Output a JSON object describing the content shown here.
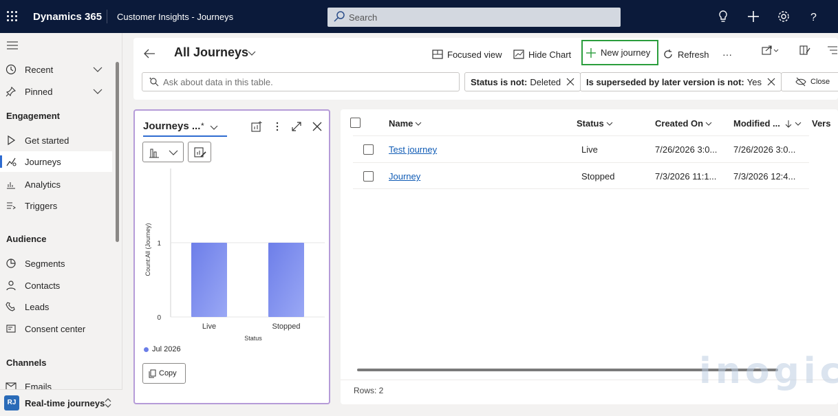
{
  "topbar": {
    "brand": "Dynamics 365",
    "app_name": "Customer Insights - Journeys",
    "search_placeholder": "Search"
  },
  "sidebar": {
    "recent": "Recent",
    "pinned": "Pinned",
    "sections": [
      {
        "header": "Engagement",
        "items": [
          "Get started",
          "Journeys",
          "Analytics",
          "Triggers"
        ]
      },
      {
        "header": "Audience",
        "items": [
          "Segments",
          "Contacts",
          "Leads",
          "Consent center"
        ]
      },
      {
        "header": "Channels",
        "items": [
          "Emails"
        ]
      }
    ],
    "active_item": "Journeys",
    "area": {
      "badge": "RJ",
      "label": "Real-time journeys"
    }
  },
  "commandbar": {
    "view_title": "All Journeys",
    "focused_view": "Focused view",
    "hide_chart": "Hide Chart",
    "new_journey": "New journey",
    "refresh": "Refresh",
    "more": "···"
  },
  "filters": {
    "ask_placeholder": "Ask about data in this table.",
    "chips": [
      {
        "label": "Status is not:",
        "value": "Deleted"
      },
      {
        "label": "Is superseded by later version is not:",
        "value": "Yes"
      }
    ],
    "close": "Close"
  },
  "chart_panel": {
    "title": "Journeys ...",
    "star": "*",
    "copy": "Copy",
    "legend": "Jul 2026"
  },
  "chart_data": {
    "type": "bar",
    "categories": [
      "Live",
      "Stopped"
    ],
    "series": [
      {
        "name": "Jul 2026",
        "values": [
          1,
          1
        ]
      }
    ],
    "xlabel": "Status",
    "ylabel": "Count:All (Journey)",
    "ylim": [
      0,
      2
    ],
    "yticks": [
      "0",
      "1"
    ],
    "color": "#7b8cf0"
  },
  "grid": {
    "columns": [
      "Name",
      "Status",
      "Created On",
      "Modified ...",
      "Vers"
    ],
    "rows": [
      {
        "name": "Test journey",
        "status": "Live",
        "created": "7/26/2026 3:0...",
        "modified": "7/26/2026 3:0..."
      },
      {
        "name": "Journey",
        "status": "Stopped",
        "created": "7/3/2026 11:1...",
        "modified": "7/3/2026 12:4..."
      }
    ],
    "rows_label": "Rows: 2"
  },
  "watermark": "inogic"
}
